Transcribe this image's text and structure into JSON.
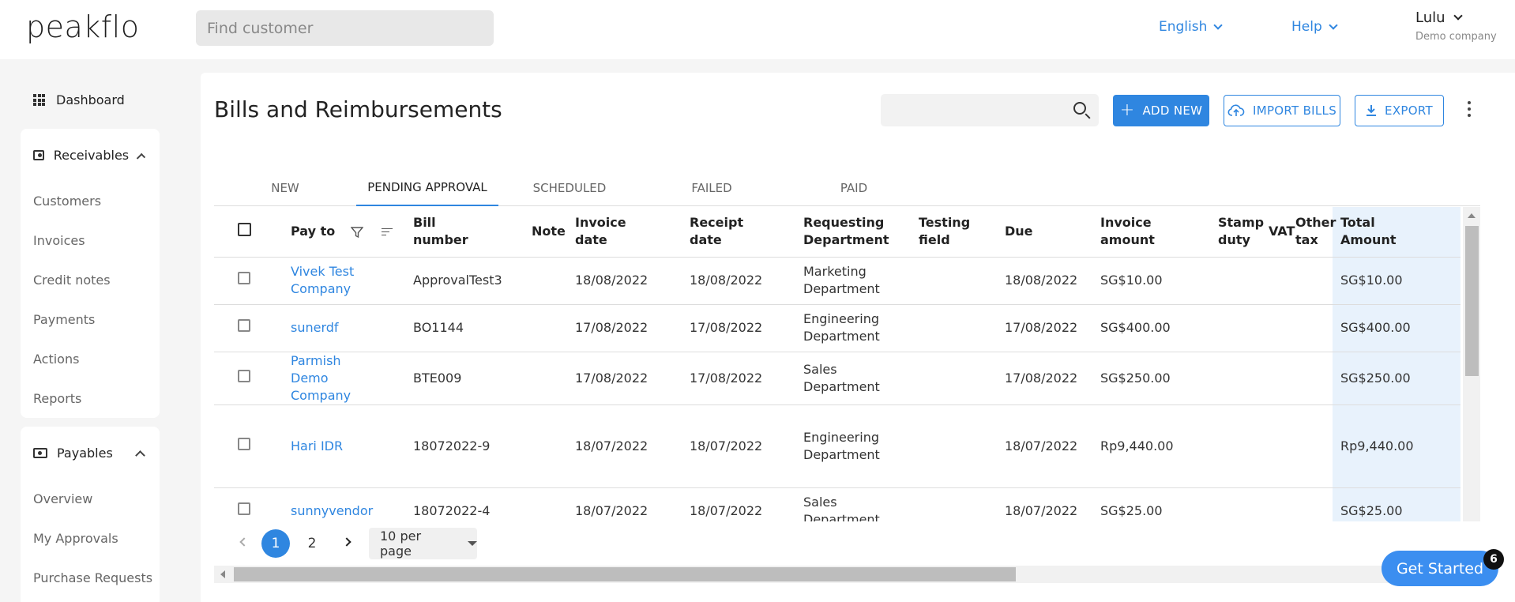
{
  "header": {
    "logo": "peakflo",
    "search_placeholder": "Find customer",
    "language": "English",
    "help": "Help",
    "user_name": "Lulu",
    "company": "Demo company"
  },
  "sidebar": {
    "dashboard": "Dashboard",
    "receivables": {
      "title": "Receivables",
      "items": [
        "Customers",
        "Invoices",
        "Credit notes",
        "Payments",
        "Actions",
        "Reports"
      ]
    },
    "payables": {
      "title": "Payables",
      "items": [
        "Overview",
        "My Approvals",
        "Purchase Requests"
      ]
    }
  },
  "page": {
    "title": "Bills and Reimbursements",
    "add_new": "ADD NEW",
    "import_bills": "IMPORT BILLS",
    "export": "EXPORT"
  },
  "tabs": [
    "NEW",
    "PENDING APPROVAL",
    "SCHEDULED",
    "FAILED",
    "PAID"
  ],
  "active_tab": "PENDING APPROVAL",
  "table": {
    "headers": {
      "pay_to": "Pay to",
      "bill_number": "Bill number",
      "note": "Note",
      "invoice_date": "Invoice date",
      "receipt_date": "Receipt date",
      "requesting_department": "Requesting Department",
      "testing_field": "Testing field",
      "due": "Due",
      "invoice_amount": "Invoice amount",
      "stamp_duty": "Stamp duty",
      "vat": "VAT",
      "other_tax": "Other tax",
      "total_amount": "Total Amount"
    },
    "rows": [
      {
        "pay_to": "Vivek Test Company",
        "bill_number": "ApprovalTest3",
        "note": "",
        "invoice_date": "18/08/2022",
        "receipt_date": "18/08/2022",
        "department": "Marketing Department",
        "testing_field": "",
        "due": "18/08/2022",
        "invoice_amount": "SG$10.00",
        "stamp_duty": "",
        "vat": "",
        "other_tax": "",
        "total": "SG$10.00"
      },
      {
        "pay_to": "sunerdf",
        "bill_number": "BO1144",
        "note": "",
        "invoice_date": "17/08/2022",
        "receipt_date": "17/08/2022",
        "department": "Engineering Department",
        "testing_field": "",
        "due": "17/08/2022",
        "invoice_amount": "SG$400.00",
        "stamp_duty": "",
        "vat": "",
        "other_tax": "",
        "total": "SG$400.00"
      },
      {
        "pay_to": "Parmish Demo Company",
        "bill_number": "BTE009",
        "note": "",
        "invoice_date": "17/08/2022",
        "receipt_date": "17/08/2022",
        "department": "Sales Department",
        "testing_field": "",
        "due": "17/08/2022",
        "invoice_amount": "SG$250.00",
        "stamp_duty": "",
        "vat": "",
        "other_tax": "",
        "total": "SG$250.00"
      },
      {
        "pay_to": "Hari IDR",
        "bill_number": "18072022-9",
        "note": "",
        "invoice_date": "18/07/2022",
        "receipt_date": "18/07/2022",
        "department": "Engineering Department",
        "testing_field": "",
        "due": "18/07/2022",
        "invoice_amount": "Rp9,440.00",
        "stamp_duty": "",
        "vat": "",
        "other_tax": "",
        "total": "Rp9,440.00"
      },
      {
        "pay_to": "sunnyvendor",
        "bill_number": "18072022-4",
        "note": "",
        "invoice_date": "18/07/2022",
        "receipt_date": "18/07/2022",
        "department": "Sales Department",
        "testing_field": "",
        "due": "18/07/2022",
        "invoice_amount": "SG$25.00",
        "stamp_duty": "",
        "vat": "",
        "other_tax": "",
        "total": "SG$25.00"
      }
    ]
  },
  "pagination": {
    "pages": [
      "1",
      "2"
    ],
    "current": "1",
    "per_page": "10 per page"
  },
  "get_started": {
    "label": "Get Started",
    "badge": "6"
  },
  "colors": {
    "accent": "#2f86e0",
    "total_column_bg": "#e8f2fc"
  }
}
